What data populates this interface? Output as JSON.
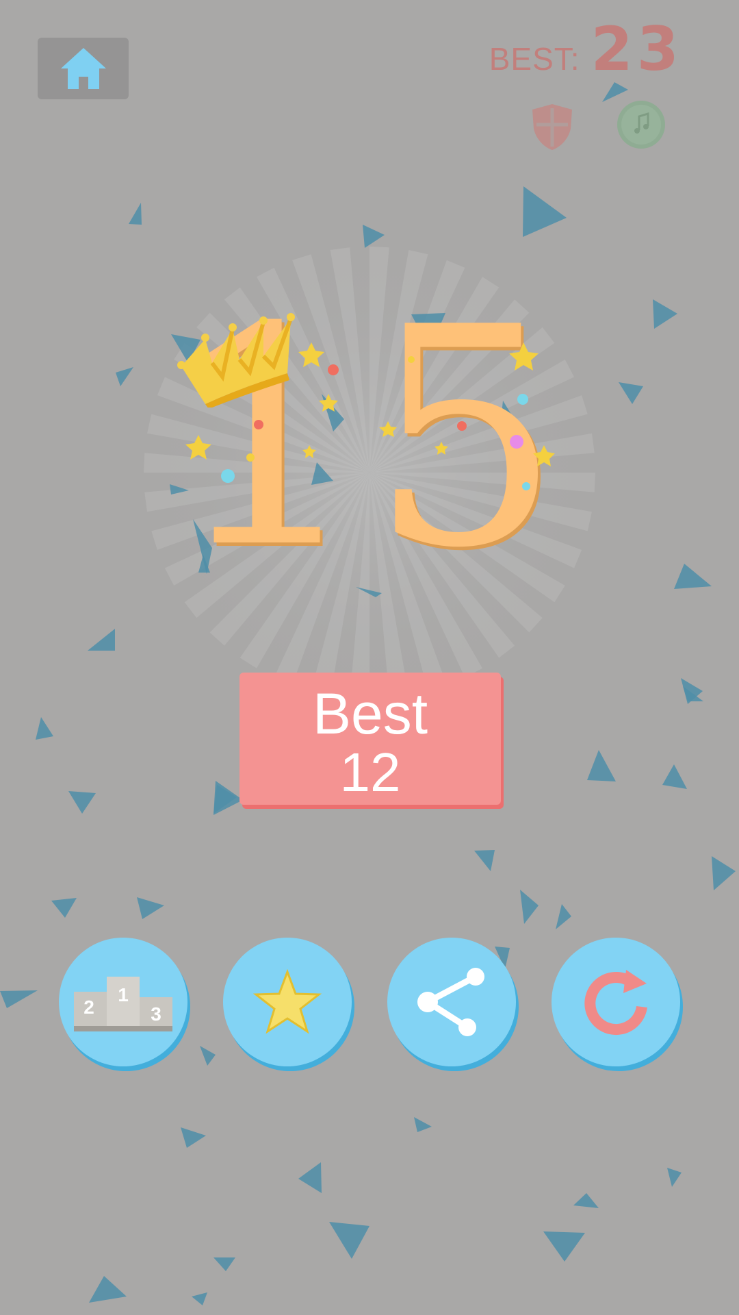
{
  "header": {
    "home_icon": "home-icon",
    "best_label": "BEST:",
    "best_value": "23",
    "shield_icon": "shield-icon",
    "music_icon": "music-note-icon"
  },
  "result": {
    "score": "15",
    "crown_icon": "crown-icon",
    "best_title": "Best",
    "best_value": "12"
  },
  "actions": [
    {
      "name": "leaderboard",
      "icon": "podium-icon",
      "podium_labels": [
        "1",
        "2",
        "3"
      ]
    },
    {
      "name": "rate",
      "icon": "star-icon"
    },
    {
      "name": "share",
      "icon": "share-icon"
    },
    {
      "name": "restart",
      "icon": "replay-icon"
    }
  ],
  "colors": {
    "background": "#a9a8a7",
    "score": "#fec178",
    "best_box": "#f49392",
    "button": "#82d3f4",
    "confetti": "#4f8ea8"
  }
}
